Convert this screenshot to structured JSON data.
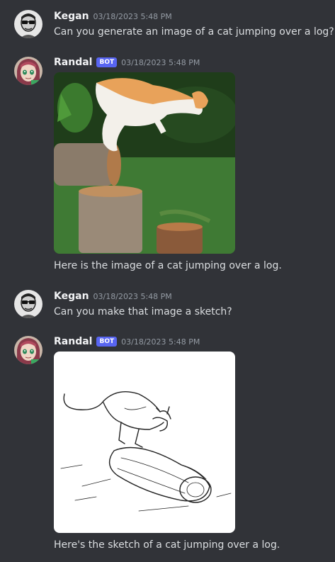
{
  "messages": [
    {
      "author": "Kegan",
      "timestamp": "03/18/2023 5:48 PM",
      "text": "Can you generate an image of a cat jumping over a log?"
    },
    {
      "author": "Randal",
      "badge": "BOT",
      "timestamp": "03/18/2023 5:48 PM",
      "attachment": "cat-photo",
      "text": "Here is the image of a cat jumping over a log."
    },
    {
      "author": "Kegan",
      "timestamp": "03/18/2023 5:48 PM",
      "text": "Can you make that image a sketch?"
    },
    {
      "author": "Randal",
      "badge": "BOT",
      "timestamp": "03/18/2023 5:48 PM",
      "attachment": "cat-sketch",
      "text": "Here's the sketch of a cat jumping over a log."
    }
  ],
  "colors": {
    "background": "#313338",
    "bot_badge": "#5865f2",
    "username": "#f2f3f5",
    "timestamp": "#949ba4"
  }
}
